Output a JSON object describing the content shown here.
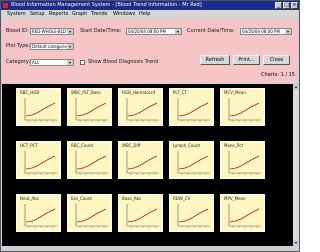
{
  "window": {
    "title": "Blood Information Management System - [Blood Trend Information - Mr Red]",
    "minimize_glyph": "_",
    "maximize_glyph": "□",
    "close_glyph": "×"
  },
  "menu": [
    "System",
    "Setup",
    "Reports",
    "Graph",
    "Trends",
    "Windows",
    "Help"
  ],
  "filters": {
    "blood_id_label": "Blood ID:",
    "blood_id_value": "RED-WHOLE-BLD",
    "start_date_label": "Start Date/Time:",
    "start_date_value": "04/20/04 08:00 PM",
    "current_date_label": "Current Date/Time:",
    "current_date_value": "04/20/04 08:00 PM",
    "plot_type_label": "Plot Type:",
    "plot_type_value": "Default categories",
    "category_label": "Category:",
    "category_value": "ALL",
    "show_blood_label": "Show Blood Diagnosis Trend",
    "refresh_label": "Refresh",
    "print_label": "Print...",
    "close_label": "Close",
    "count_label": "Charts: 1 / 15"
  },
  "icons": {
    "app": "app-icon",
    "combo_arrow": "▾",
    "scroll_up": "▴",
    "scroll_down": "▾"
  },
  "colors": {
    "titlebar": "#1a2c8c",
    "filter_panel": "#f6c5c7",
    "grid_background": "#000000",
    "thumbnail": "#fff6c2",
    "plot_line": "#c01818"
  },
  "thumbnails": [
    {
      "label": "RBC_HGB"
    },
    {
      "label": "WBC_PLT_Baso"
    },
    {
      "label": "HGB_Hematocrit"
    },
    {
      "label": "PLT_CT"
    },
    {
      "label": "MCV_Mean"
    },
    {
      "label": "HCT_PCT"
    },
    {
      "label": "RBC_Count"
    },
    {
      "label": "WBC_Diff"
    },
    {
      "label": "Lymph_Count"
    },
    {
      "label": "Mono_Pct"
    },
    {
      "label": "Neut_Abs"
    },
    {
      "label": "Eos_Count"
    },
    {
      "label": "Baso_Abs"
    },
    {
      "label": "RDW_CV"
    },
    {
      "label": "MPV_Mean"
    }
  ]
}
